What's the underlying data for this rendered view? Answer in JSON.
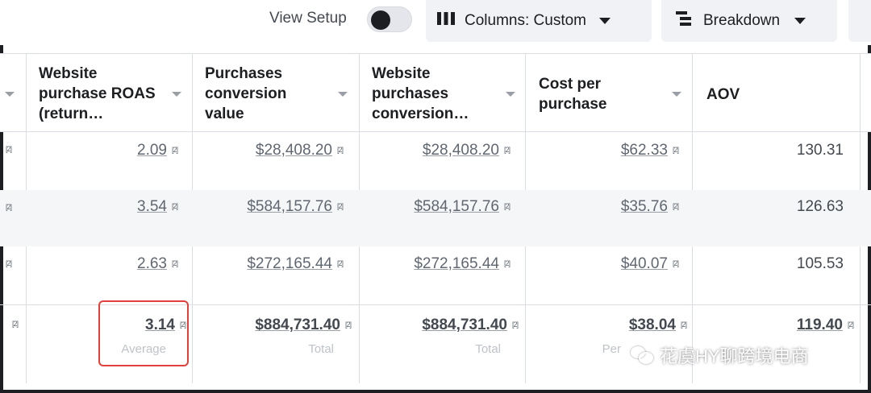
{
  "toolbar": {
    "view_setup_label": "View Setup",
    "view_setup_on": false,
    "columns_label": "Columns: Custom",
    "breakdown_label": "Breakdown"
  },
  "table": {
    "headers": [
      "",
      "Website purchase ROAS (return…",
      "Purchases conversion value",
      "Website purchases conversion…",
      "Cost per purchase",
      "AOV"
    ],
    "rows": [
      {
        "roas": "2.09",
        "purchases_value": "$28,408.20",
        "website_value": "$28,408.20",
        "cost_per_purchase": "$62.33",
        "aov": "130.31"
      },
      {
        "roas": "3.54",
        "purchases_value": "$584,157.76",
        "website_value": "$584,157.76",
        "cost_per_purchase": "$35.76",
        "aov": "126.63"
      },
      {
        "roas": "2.63",
        "purchases_value": "$272,165.44",
        "website_value": "$272,165.44",
        "cost_per_purchase": "$40.07",
        "aov": "105.53"
      }
    ],
    "total_row": {
      "roas": "3.14",
      "roas_label": "Average",
      "purchases_value": "$884,731.40",
      "purchases_value_label": "Total",
      "website_value": "$884,731.40",
      "website_value_label": "Total",
      "cost_per_purchase": "$38.04",
      "cost_per_purchase_label": "Per",
      "aov": "119.40"
    },
    "info_marker": "[2]"
  },
  "watermark": {
    "text": "花虞HY聊跨境电商"
  },
  "colors": {
    "highlight": "#e0413a",
    "row_band": "#f5f6f7",
    "toolbar_button_bg": "#f0f2f5"
  },
  "icons": {
    "columns": "columns-icon",
    "breakdown": "breakdown-icon",
    "dropdown": "caret-down-icon",
    "sort": "sort-caret-icon",
    "info": "info-icon",
    "watermark": "wechat-icon"
  }
}
